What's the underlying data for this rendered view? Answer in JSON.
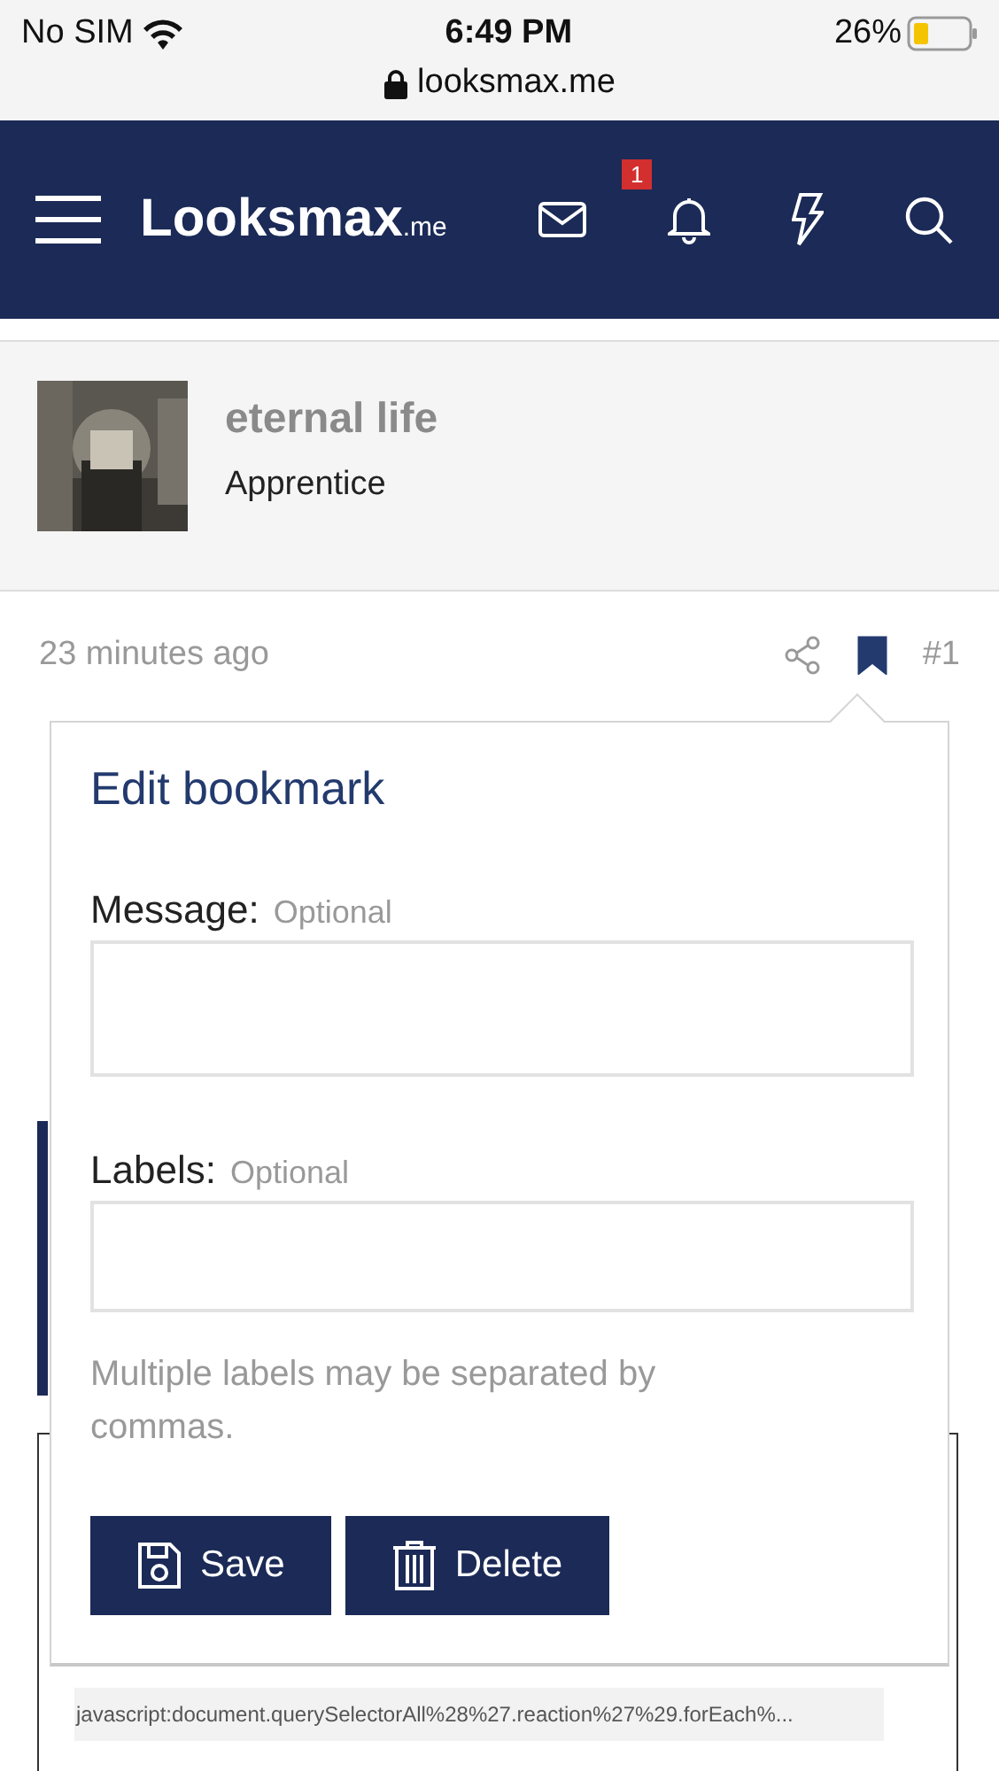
{
  "status_bar": {
    "carrier": "No SIM",
    "time": "6:49 PM",
    "battery": "26%",
    "url": "looksmax.me"
  },
  "nav": {
    "logo": "Looksmax",
    "logo_suffix": ".me",
    "alerts_badge": "1"
  },
  "post": {
    "author": "eternal life",
    "user_title": "Apprentice",
    "time": "23 minutes ago",
    "number": "#1",
    "bookmarked": true,
    "link_preview": "javascript:document.querySelectorAll%28%27.reaction%27%29.forEach%..."
  },
  "popover": {
    "title": "Edit bookmark",
    "fields": [
      {
        "label": "Message:",
        "hint": "Optional",
        "kind": "textarea"
      },
      {
        "label": "Labels:",
        "hint": "Optional",
        "kind": "input"
      }
    ],
    "help": "Multiple labels may be separated by commas.",
    "buttons": [
      {
        "label": "Save",
        "kind": "save"
      },
      {
        "label": "Delete",
        "kind": "delete"
      }
    ]
  }
}
